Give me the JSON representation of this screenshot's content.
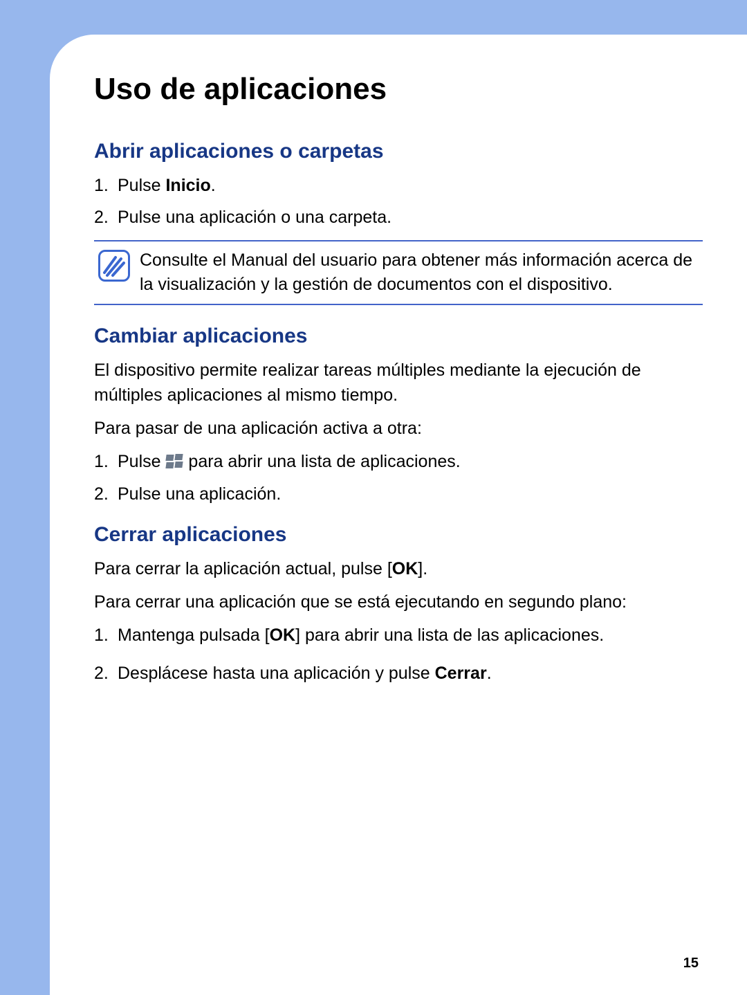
{
  "page_number": "15",
  "title": "Uso de aplicaciones",
  "section1": {
    "heading": "Abrir aplicaciones o carpetas",
    "step1_pre": "Pulse ",
    "step1_bold": "Inicio",
    "step1_post": ".",
    "step2": "Pulse una aplicación o una carpeta.",
    "note": "Consulte el Manual del usuario para obtener más información acerca de la visualización y la gestión de documentos con el dispositivo."
  },
  "section2": {
    "heading": "Cambiar aplicaciones",
    "intro": "El dispositivo permite realizar tareas múltiples mediante la ejecución de múltiples aplicaciones al mismo tiempo.",
    "lead": "Para pasar de una aplicación activa a otra:",
    "step1_pre": "Pulse ",
    "step1_post": " para abrir una lista de aplicaciones.",
    "step2": "Pulse una aplicación."
  },
  "section3": {
    "heading": "Cerrar aplicaciones",
    "p1_pre": "Para cerrar la aplicación actual, pulse [",
    "p1_bold": "OK",
    "p1_post": "].",
    "p2": "Para cerrar una aplicación que se está ejecutando en segundo plano:",
    "step1_pre": "Mantenga pulsada [",
    "step1_bold": "OK",
    "step1_post": "] para abrir una lista de las aplicaciones.",
    "step2_pre": "Desplácese hasta una aplicación y pulse ",
    "step2_bold": "Cerrar",
    "step2_post": "."
  }
}
